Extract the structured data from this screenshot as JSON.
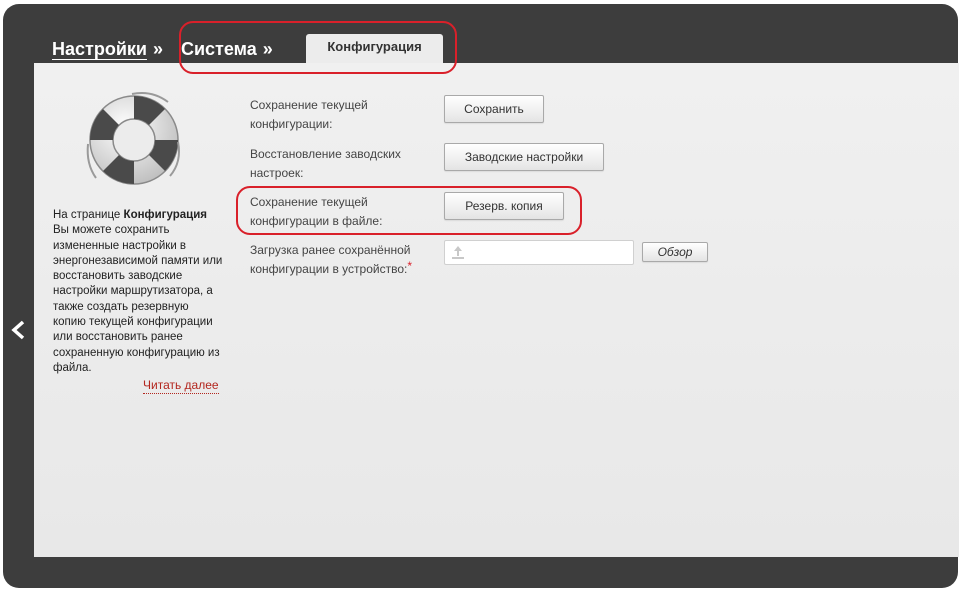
{
  "breadcrumb": {
    "settings": "Настройки",
    "separator": "»",
    "system": "Система",
    "active_tab": "Конфигурация"
  },
  "info_panel": {
    "icon": "lifebuoy-icon",
    "lead": "На странице",
    "page_name": "Конфигурация",
    "body": "Вы можете сохранить измененные настройки в энергонезависимой памяти или восстановить заводские настройки маршрутизатора, а также создать резервную копию текущей конфигурации или восстановить ранее сохраненную конфигурацию из файла.",
    "read_more": "Читать далее"
  },
  "form": {
    "save_label": "Сохранение текущей конфигурации:",
    "save_button": "Сохранить",
    "factory_label": "Восстановление заводских настроек:",
    "factory_button": "Заводские настройки",
    "backup_label": "Сохранение текущей конфигурации в файле:",
    "backup_button": "Резерв. копия",
    "upload_label": "Загрузка ранее сохранённой конфигурации в устройство:",
    "upload_required_mark": "*",
    "upload_value": "",
    "browse_button": "Обзор"
  },
  "colors": {
    "frame": "#3d3d3d",
    "content_bg": "#ebebeb",
    "highlight": "#d9202a",
    "link": "#b3261e"
  }
}
